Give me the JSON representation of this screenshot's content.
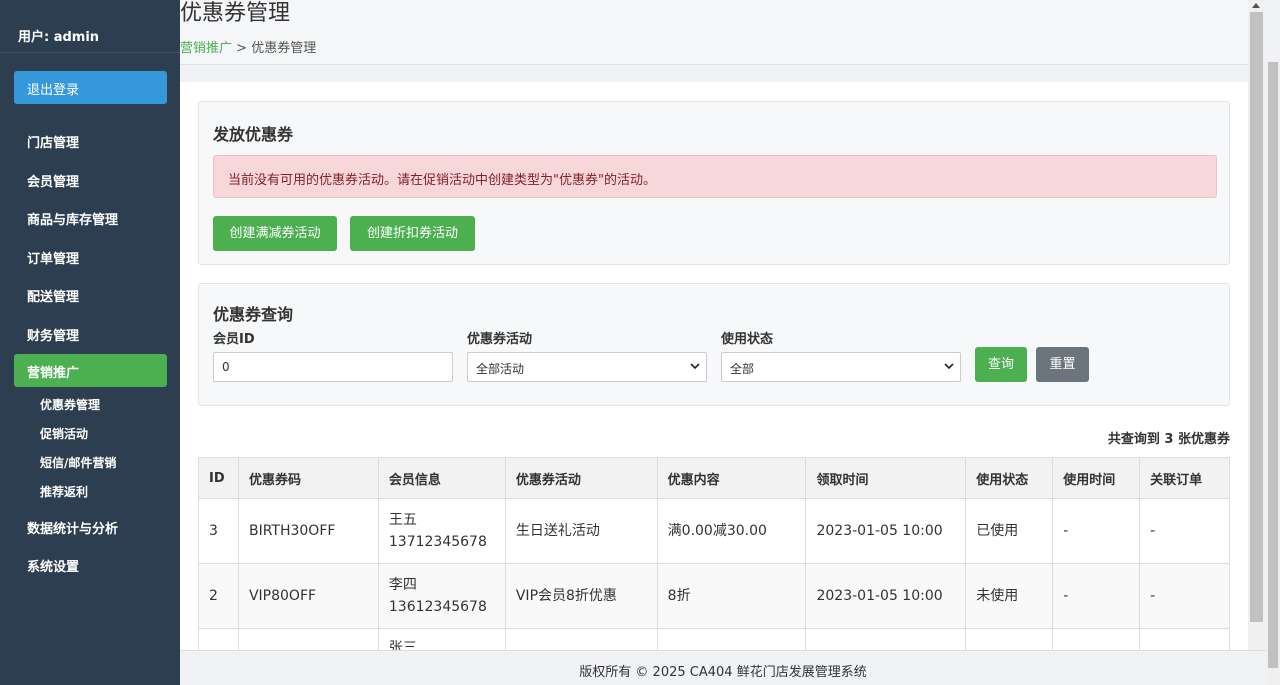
{
  "sidebar": {
    "user_label": "用户: admin",
    "logout_label": "退出登录",
    "items": [
      {
        "label": "门店管理"
      },
      {
        "label": "会员管理"
      },
      {
        "label": "商品与库存管理"
      },
      {
        "label": "订单管理"
      },
      {
        "label": "配送管理"
      },
      {
        "label": "财务管理"
      },
      {
        "label": "营销推广"
      },
      {
        "label": "数据统计与分析"
      },
      {
        "label": "系统设置"
      }
    ],
    "subitems": [
      {
        "label": "优惠券管理"
      },
      {
        "label": "促销活动"
      },
      {
        "label": "短信/邮件营销"
      },
      {
        "label": "推荐返利"
      }
    ]
  },
  "header": {
    "title": "优惠券管理",
    "breadcrumb_link": "营销推广",
    "breadcrumb_sep": ">",
    "breadcrumb_current": "优惠券管理"
  },
  "issue": {
    "title": "发放优惠券",
    "alert": "当前没有可用的优惠券活动。请在促销活动中创建类型为\"优惠券\"的活动。",
    "btn_full_reduce": "创建满减券活动",
    "btn_discount": "创建折扣券活动"
  },
  "query": {
    "title": "优惠券查询",
    "member_label": "会员ID",
    "member_value": "0",
    "activity_label": "优惠券活动",
    "activity_value": "全部活动",
    "status_label": "使用状态",
    "status_value": "全部",
    "search_btn": "查询",
    "reset_btn": "重置"
  },
  "result": {
    "prefix": "共查询到",
    "count": "3",
    "suffix": "张优惠券"
  },
  "table": {
    "headers": [
      "ID",
      "优惠券码",
      "会员信息",
      "优惠券活动",
      "优惠内容",
      "领取时间",
      "使用状态",
      "使用时间",
      "关联订单"
    ],
    "rows": [
      {
        "id": "3",
        "code": "BIRTH30OFF",
        "member_name": "王五",
        "member_phone": "13712345678",
        "activity": "生日送礼活动",
        "content": "满0.00减30.00",
        "time": "2023-01-05 10:00",
        "status": "已使用",
        "used_time": "-",
        "order": "-"
      },
      {
        "id": "2",
        "code": "VIP80OFF",
        "member_name": "李四",
        "member_phone": "13612345678",
        "activity": "VIP会员8折优惠",
        "content": "8折",
        "time": "2023-01-05 10:00",
        "status": "未使用",
        "used_time": "-",
        "order": "-"
      },
      {
        "id": "",
        "code": "",
        "member_name": "张三",
        "member_phone": "",
        "activity": "",
        "content": "",
        "time": "",
        "status": "",
        "used_time": "",
        "order": ""
      }
    ]
  },
  "footer": {
    "text": "版权所有 © 2025 CA404 鲜花门店发展管理系统"
  }
}
